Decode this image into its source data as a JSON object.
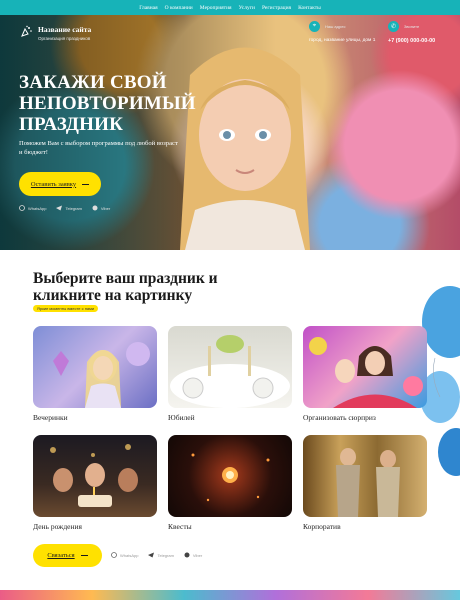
{
  "nav": {
    "items": [
      "Главная",
      "О компании",
      "Мероприятия",
      "Услуги",
      "Регистрация",
      "Контакты"
    ]
  },
  "header": {
    "site_name": "Название сайта",
    "site_tagline": "Организация праздников",
    "address_label": "Наш адрес",
    "address": "город, название улицы, дом 1",
    "phone_label": "Звоните",
    "phone": "+7 (900) 000-00-00"
  },
  "hero": {
    "title": "ЗАКАЖИ СВОЙ НЕПОВТОРИМЫЙ ПРАЗДНИК",
    "subtitle": "Поможем Вам с выбором программы под любой возраст и бюджет!",
    "cta_label": "Оставить заявку",
    "social": [
      "WhatsApp",
      "Telegram",
      "Viber"
    ]
  },
  "events": {
    "title": "Выберите ваш праздник и кликните на картинку",
    "badge": "Яркие моменты вместе с нами",
    "cards": [
      {
        "label": "Вечеринки"
      },
      {
        "label": "Юбилей"
      },
      {
        "label": "Организовать сюрприз"
      },
      {
        "label": "День рождения"
      },
      {
        "label": "Квесты"
      },
      {
        "label": "Корпоратив"
      }
    ],
    "cta_label": "Связаться",
    "social": [
      "WhatsApp",
      "Telegram",
      "Viber"
    ]
  },
  "colors": {
    "accent": "#17b3b8",
    "button": "#ffe100",
    "text": "#1a1a1a"
  },
  "icons": [
    "sparkle-logo-icon",
    "location-icon",
    "phone-icon",
    "whatsapp-icon",
    "telegram-icon",
    "viber-icon",
    "balloon-icon"
  ]
}
